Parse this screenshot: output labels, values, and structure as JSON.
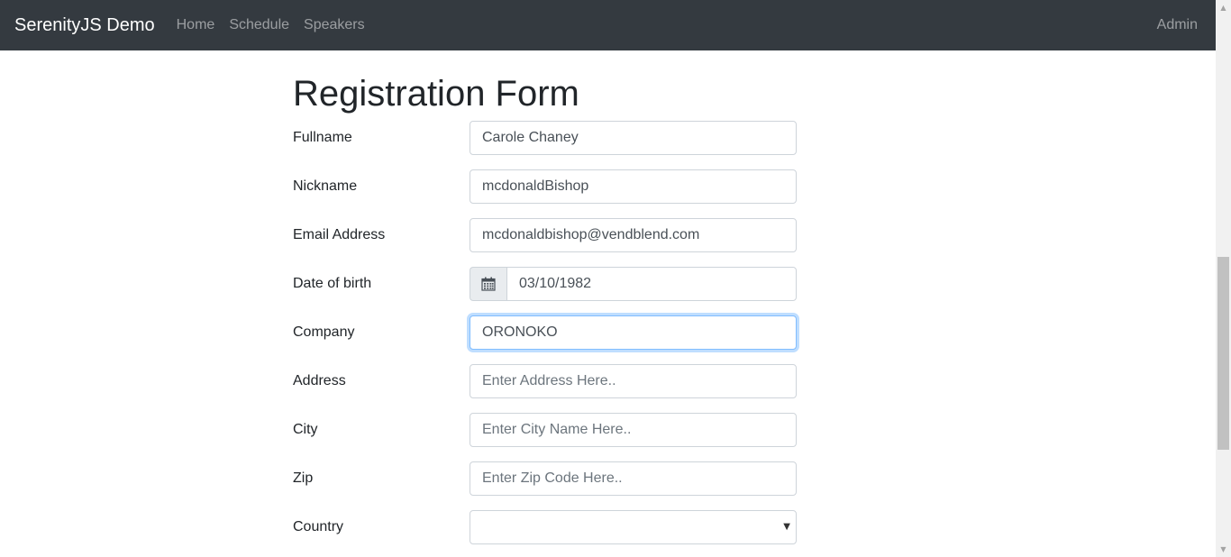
{
  "nav": {
    "brand": "SerenityJS Demo",
    "links": [
      "Home",
      "Schedule",
      "Speakers"
    ],
    "admin": "Admin"
  },
  "form": {
    "title": "Registration Form",
    "fields": {
      "fullname": {
        "label": "Fullname",
        "value": "Carole Chaney",
        "placeholder": ""
      },
      "nickname": {
        "label": "Nickname",
        "value": "mcdonaldBishop",
        "placeholder": ""
      },
      "email": {
        "label": "Email Address",
        "value": "mcdonaldbishop@vendblend.com",
        "placeholder": ""
      },
      "dob": {
        "label": "Date of birth",
        "value": "03/10/1982",
        "icon": "calendar-icon"
      },
      "company": {
        "label": "Company",
        "value": "ORONOKO",
        "placeholder": ""
      },
      "address": {
        "label": "Address",
        "value": "",
        "placeholder": "Enter Address Here.."
      },
      "city": {
        "label": "City",
        "value": "",
        "placeholder": "Enter City Name Here.."
      },
      "zip": {
        "label": "Zip",
        "value": "",
        "placeholder": "Enter Zip Code Here.."
      },
      "country": {
        "label": "Country",
        "value": ""
      }
    }
  },
  "colors": {
    "navbar": "#343a40",
    "focus_border": "#80bdff"
  }
}
